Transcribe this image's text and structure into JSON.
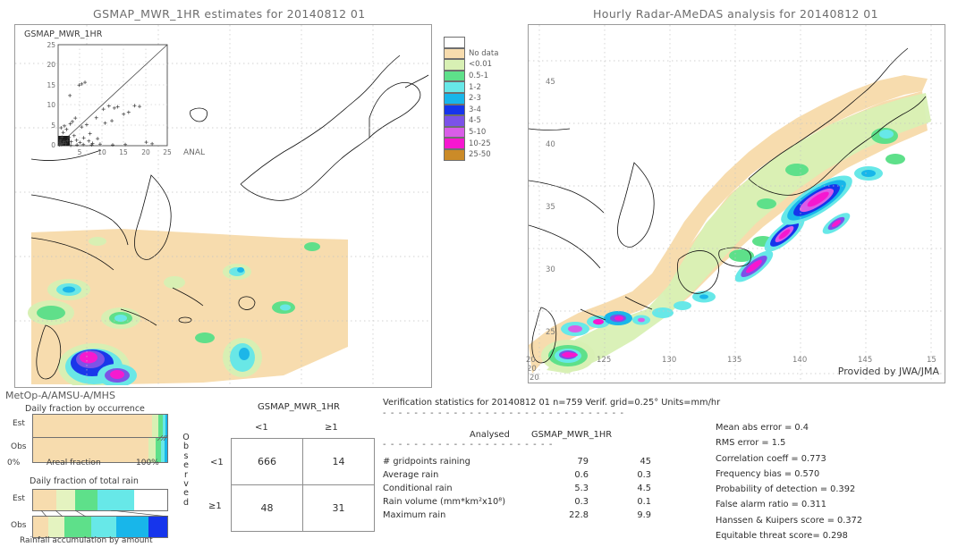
{
  "left_panel": {
    "title": "GSMAP_MWR_1HR estimates for 20140812 01",
    "inset": {
      "label": "GSMAP_MWR_1HR",
      "y_ticks": [
        "25",
        "20",
        "15",
        "10",
        "5",
        "0"
      ],
      "x_ticks": [
        "5",
        "10",
        "15",
        "20",
        "25"
      ],
      "x_axis_label": "ANAL"
    },
    "legend": {
      "entries": [
        {
          "label": "",
          "color": "#ffffff"
        },
        {
          "label": "No data",
          "color": "#f7dcae"
        },
        {
          "label": "<0.01",
          "color": "#d8f0b4"
        },
        {
          "label": "0.5-1",
          "color": "#5ee08a"
        },
        {
          "label": "1-2",
          "color": "#67e8e8"
        },
        {
          "label": "2-3",
          "color": "#18b6ea"
        },
        {
          "label": "3-4",
          "color": "#1635ec"
        },
        {
          "label": "4-5",
          "color": "#7b52e8"
        },
        {
          "label": "5-10",
          "color": "#d95de8"
        },
        {
          "label": "10-25",
          "color": "#f617d0"
        },
        {
          "label": "25-50",
          "color": "#cb8b28"
        }
      ]
    }
  },
  "right_panel": {
    "title": "Hourly Radar-AMeDAS analysis for 20140812 01",
    "credit": "Provided by JWA/JMA",
    "x_ticks": [
      "20",
      "125",
      "130",
      "135",
      "140",
      "145",
      "15"
    ],
    "y_ticks": [
      "45",
      "40",
      "35",
      "30",
      "25",
      "20"
    ]
  },
  "sensor_panel": {
    "sensor": "MetOp-A/AMSU-A/MHS",
    "chart1": {
      "title": "Daily fraction by occurrence",
      "rows": [
        "Est",
        "Obs"
      ],
      "x_left": "0%",
      "x_center": "Areal fraction",
      "x_right": "100%"
    },
    "chart2": {
      "title": "Daily fraction of total rain",
      "rows": [
        "Est",
        "Obs"
      ],
      "caption": "Rainfall accumulation by amount"
    }
  },
  "contingency": {
    "column_group_header": "GSMAP_MWR_1HR",
    "col_headers": [
      "<1",
      "≥1"
    ],
    "row_axis_label": "Observed",
    "row_headers": [
      "<1",
      "≥1"
    ],
    "cells": [
      [
        "666",
        "14"
      ],
      [
        "48",
        "31"
      ]
    ]
  },
  "verification": {
    "header": "Verification statistics for 20140812 01  n=759  Verif. grid=0.25°  Units=mm/hr",
    "table_headers": [
      "Analysed",
      "GSMAP_MWR_1HR"
    ],
    "rows": [
      {
        "label": "# gridpoints raining",
        "analysed": "79",
        "estimate": "45"
      },
      {
        "label": "Average rain",
        "analysed": "0.6",
        "estimate": "0.3"
      },
      {
        "label": "Conditional rain",
        "analysed": "5.3",
        "estimate": "4.5"
      },
      {
        "label": "Rain volume (mm*km²x10⁸)",
        "analysed": "0.3",
        "estimate": "0.1"
      },
      {
        "label": "Maximum rain",
        "analysed": "22.8",
        "estimate": "9.9"
      }
    ],
    "scores": [
      "Mean abs error = 0.4",
      "RMS error = 1.5",
      "Correlation coeff = 0.773",
      "Frequency bias = 0.570",
      "Probability of detection = 0.392",
      "False alarm ratio = 0.311",
      "Hanssen & Kuipers score = 0.372",
      "Equitable threat score= 0.298"
    ]
  },
  "chart_data": [
    {
      "type": "bar",
      "title": "Daily fraction by occurrence",
      "xlabel": "Areal fraction",
      "categories": [
        "Est",
        "Obs"
      ],
      "series": [
        {
          "name": "No data",
          "color": "#f7dcae",
          "values": [
            88.5,
            86.0
          ]
        },
        {
          "name": "<0.01",
          "color": "#d8f0b4",
          "values": [
            5.0,
            5.5
          ]
        },
        {
          "name": "0.5-1",
          "color": "#5ee08a",
          "values": [
            3.0,
            4.0
          ]
        },
        {
          "name": "1-2",
          "color": "#67e8e8",
          "values": [
            2.0,
            2.5
          ]
        },
        {
          "name": "2-3",
          "color": "#18b6ea",
          "values": [
            1.5,
            2.0
          ]
        }
      ],
      "xlim": [
        0,
        100
      ],
      "grid": false
    },
    {
      "type": "bar",
      "title": "Daily fraction of total rain",
      "xlabel": "Rainfall accumulation by amount",
      "categories": [
        "Est",
        "Obs"
      ],
      "series": [
        {
          "name": "No data",
          "color": "#f7dcae",
          "values": [
            17.0,
            11.0
          ]
        },
        {
          "name": "<0.01",
          "color": "#e4f3c0",
          "values": [
            14.0,
            12.0
          ]
        },
        {
          "name": "0.5-1",
          "color": "#5ee08a",
          "values": [
            17.0,
            20.0
          ]
        },
        {
          "name": "1-2",
          "color": "#67e8e8",
          "values": [
            27.0,
            19.0
          ]
        },
        {
          "name": "2-3",
          "color": "#18b6ea",
          "values": [
            0.0,
            24.0
          ]
        },
        {
          "name": "3-4",
          "color": "#1635ec",
          "values": [
            0.0,
            14.0
          ]
        }
      ],
      "xlim": [
        0,
        100
      ],
      "grid": false
    },
    {
      "type": "scatter",
      "title": "GSMAP_MWR_1HR",
      "xlabel": "ANAL",
      "ylabel": "GSMAP_MWR_1HR",
      "xlim": [
        0,
        26
      ],
      "ylim": [
        0,
        26
      ],
      "points": [
        [
          0.3,
          0.2
        ],
        [
          0.5,
          0.4
        ],
        [
          0.4,
          0.9
        ],
        [
          0.8,
          0.3
        ],
        [
          1.1,
          0.6
        ],
        [
          0.6,
          1.4
        ],
        [
          1.4,
          1.1
        ],
        [
          0.9,
          2.2
        ],
        [
          1.8,
          0.5
        ],
        [
          2.2,
          1.3
        ],
        [
          1.2,
          3.4
        ],
        [
          2.6,
          2.1
        ],
        [
          3.1,
          1.0
        ],
        [
          0.7,
          4.6
        ],
        [
          1.5,
          5.1
        ],
        [
          2.0,
          4.2
        ],
        [
          3.8,
          2.6
        ],
        [
          4.4,
          1.4
        ],
        [
          5.2,
          0.8
        ],
        [
          2.9,
          5.6
        ],
        [
          3.4,
          6.2
        ],
        [
          6.1,
          2.0
        ],
        [
          7.3,
          1.2
        ],
        [
          5.6,
          4.8
        ],
        [
          4.1,
          7.1
        ],
        [
          8.2,
          0.6
        ],
        [
          9.4,
          1.8
        ],
        [
          6.8,
          5.4
        ],
        [
          5.0,
          15.6
        ],
        [
          5.6,
          15.9
        ],
        [
          6.4,
          16.3
        ],
        [
          2.8,
          12.9
        ],
        [
          10.8,
          9.4
        ],
        [
          12.1,
          10.2
        ],
        [
          13.4,
          9.7
        ],
        [
          14.2,
          10.0
        ],
        [
          15.6,
          8.1
        ],
        [
          16.8,
          8.6
        ],
        [
          18.2,
          10.3
        ],
        [
          19.4,
          10.1
        ],
        [
          21.0,
          0.9
        ],
        [
          22.4,
          0.5
        ],
        [
          11.2,
          5.8
        ],
        [
          12.8,
          6.4
        ],
        [
          9.1,
          7.2
        ],
        [
          7.6,
          3.1
        ],
        [
          3.0,
          0.1
        ],
        [
          4.5,
          0.2
        ],
        [
          6.0,
          0.3
        ],
        [
          8.0,
          0.2
        ],
        [
          10.0,
          0.4
        ],
        [
          13.0,
          0.2
        ],
        [
          16.0,
          0.3
        ]
      ],
      "reference_line": "1:1"
    }
  ]
}
